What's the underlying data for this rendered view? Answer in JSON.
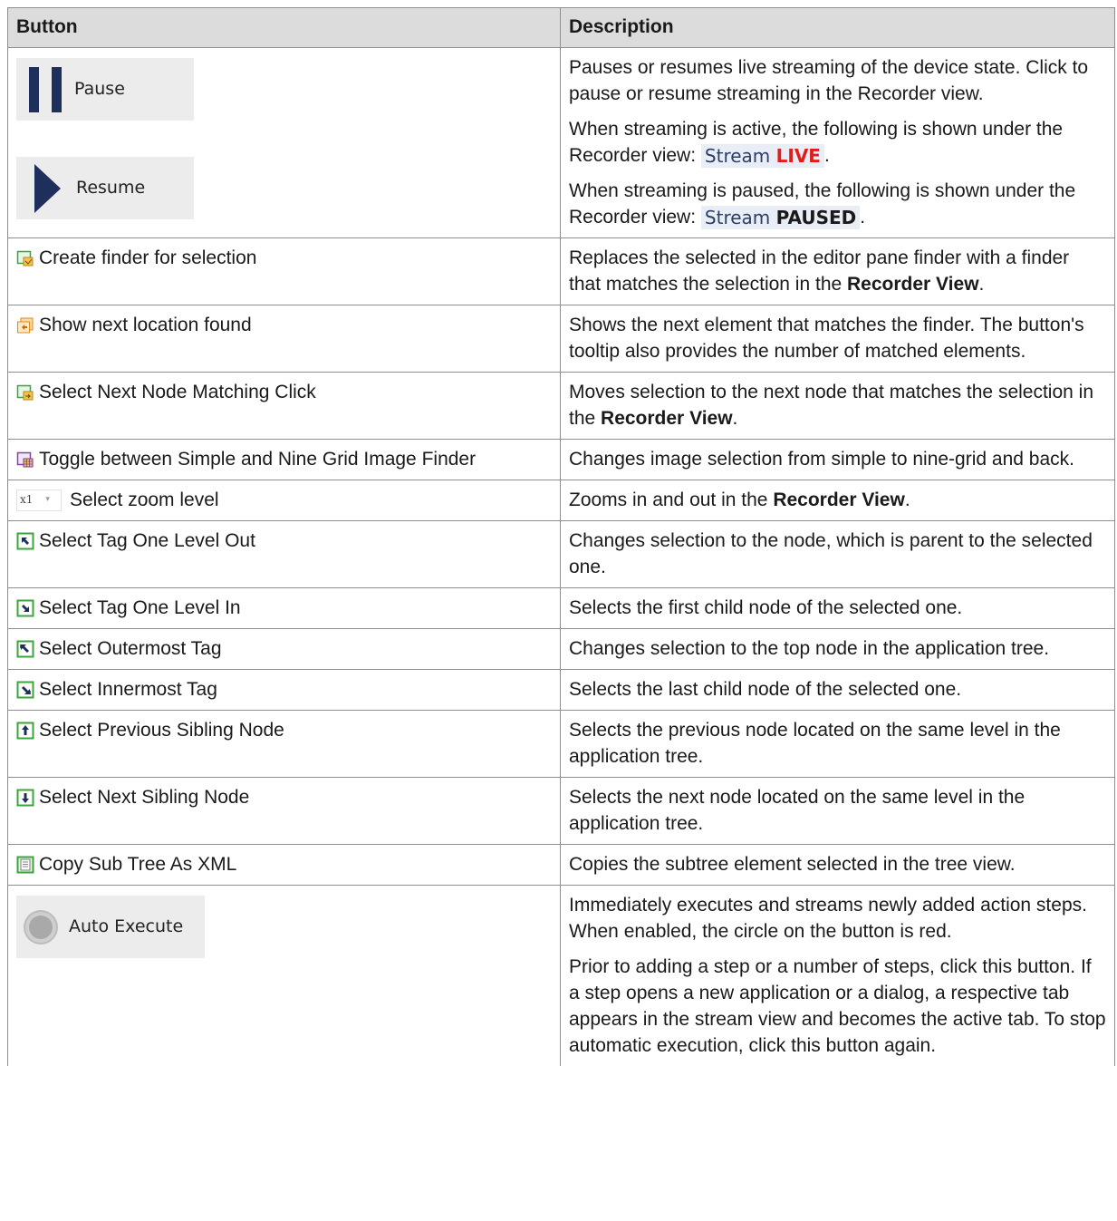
{
  "header": {
    "col1": "Button",
    "col2": "Description"
  },
  "pause_resume": {
    "pause_label": "Pause",
    "resume_label": "Resume",
    "desc1": "Pauses or resumes live streaming of the device state. Click to pause or resume streaming in the Recorder view.",
    "desc2_prefix": "When streaming is active, the following is shown under the Recorder view:",
    "badge_stream_live": "Stream",
    "badge_live": "LIVE",
    "desc3_prefix": "When streaming is paused, the following is shown under the Recorder view:",
    "badge_stream_paused": "Stream",
    "badge_paused": "PAUSED",
    "period": "."
  },
  "rows": [
    {
      "label": "Create finder for selection",
      "icon": "create-finder-icon",
      "desc_parts": [
        "Replaces the selected in the editor pane finder with a finder that matches the selection in the ",
        "Recorder View",
        "."
      ]
    },
    {
      "label": "Show next location found",
      "icon": "next-location-icon",
      "desc_parts": [
        "Shows the next element that matches the finder. The button's tooltip also provides the number of matched elements."
      ]
    },
    {
      "label": "Select Next Node Matching Click",
      "icon": "next-node-icon",
      "desc_parts": [
        "Moves selection to the next node that matches the selection in the ",
        "Recorder View",
        "."
      ]
    },
    {
      "label": "Toggle between Simple and Nine Grid Image Finder",
      "icon": "nine-grid-icon",
      "desc_parts": [
        "Changes image selection from simple to nine-grid and back."
      ]
    },
    {
      "label": "Select zoom level",
      "icon": "zoom-select",
      "zoom_value": "x1",
      "desc_parts": [
        "Zooms in and out in the ",
        "Recorder View",
        "."
      ]
    },
    {
      "label": "Select Tag One Level Out",
      "icon": "level-out-icon",
      "desc_parts": [
        "Changes selection to the node, which is parent to the selected one."
      ]
    },
    {
      "label": "Select Tag One Level In",
      "icon": "level-in-icon",
      "desc_parts": [
        "Selects the first child node of the selected one."
      ]
    },
    {
      "label": "Select Outermost Tag",
      "icon": "outermost-icon",
      "desc_parts": [
        "Changes selection to the top node in the application tree."
      ]
    },
    {
      "label": "Select Innermost Tag",
      "icon": "innermost-icon",
      "desc_parts": [
        "Selects the last child node of the selected one."
      ]
    },
    {
      "label": "Select Previous Sibling Node",
      "icon": "previous-sibling-icon",
      "desc_parts": [
        "Selects the previous node located on the same level in the application tree."
      ]
    },
    {
      "label": "Select Next Sibling Node",
      "icon": "next-sibling-icon",
      "desc_parts": [
        "Selects the next node located on the same level in the application tree."
      ]
    },
    {
      "label": "Copy Sub Tree As XML",
      "icon": "copy-xml-icon",
      "desc_parts": [
        "Copies the subtree element selected in the tree view."
      ]
    }
  ],
  "auto_execute": {
    "label": "Auto Execute",
    "desc1": "Immediately executes and streams newly added action steps. When enabled, the circle on the button is red.",
    "desc2": "Prior to adding a step or a number of steps, click this button. If a step opens a new application or a dialog, a respective tab appears in the stream view and becomes the active tab. To stop automatic execution, click this button again."
  },
  "colors": {
    "button_navy": "#1d2f5a",
    "live_red": "#e21b1b",
    "header_bg": "#dcdcdc",
    "icon_green": "#3aa53a"
  }
}
